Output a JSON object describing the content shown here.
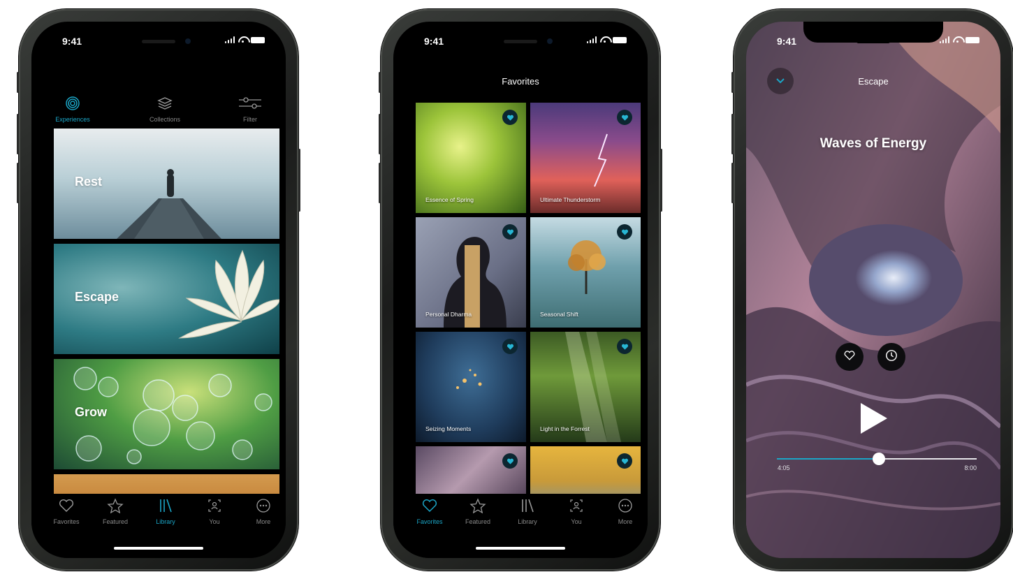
{
  "colors": {
    "accent": "#1ba6c7",
    "background": "#000000",
    "inactive": "#8a8a8a"
  },
  "status_bar": {
    "time": "9:41"
  },
  "library_screen": {
    "segments": [
      {
        "label": "Experiences",
        "icon": "spiral-icon",
        "active": true
      },
      {
        "label": "Collections",
        "icon": "stack-icon",
        "active": false
      },
      {
        "label": "Filter",
        "icon": "sliders-icon",
        "active": false
      }
    ],
    "cards": [
      "Rest",
      "Escape",
      "Grow"
    ],
    "tab_bar": [
      {
        "label": "Favorites",
        "icon": "heart-icon",
        "active": false
      },
      {
        "label": "Featured",
        "icon": "star-icon",
        "active": false
      },
      {
        "label": "Library",
        "icon": "library-icon",
        "active": true
      },
      {
        "label": "You",
        "icon": "profile-icon",
        "active": false
      },
      {
        "label": "More",
        "icon": "ellipsis-icon",
        "active": false
      }
    ]
  },
  "favorites_screen": {
    "title": "Favorites",
    "tiles": [
      {
        "caption": "Essence of Spring"
      },
      {
        "caption": "Ultimate Thunderstorm"
      },
      {
        "caption": "Personal Dharma"
      },
      {
        "caption": "Seasonal Shift"
      },
      {
        "caption": "Seizing Moments"
      },
      {
        "caption": "Light in the Forrest"
      },
      {
        "caption": ""
      },
      {
        "caption": ""
      }
    ],
    "tab_bar": [
      {
        "label": "Favorites",
        "icon": "heart-icon",
        "active": true
      },
      {
        "label": "Featured",
        "icon": "star-icon",
        "active": false
      },
      {
        "label": "Library",
        "icon": "library-icon",
        "active": false
      },
      {
        "label": "You",
        "icon": "profile-icon",
        "active": false
      },
      {
        "label": "More",
        "icon": "ellipsis-icon",
        "active": false
      }
    ]
  },
  "player_screen": {
    "category": "Escape",
    "track_title": "Waves of Energy",
    "elapsed": "4:05",
    "duration": "8:00",
    "progress": 0.51
  }
}
